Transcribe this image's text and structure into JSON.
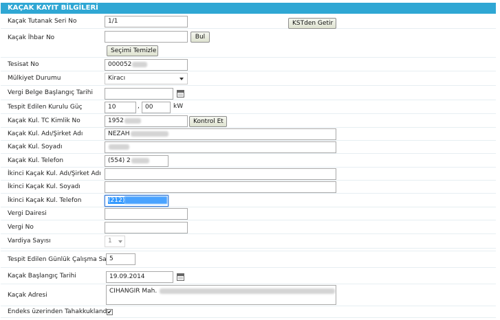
{
  "header": {
    "title": "KAÇAK KAYIT BİLGİLERİ"
  },
  "labels": {
    "tutanak_seri_no": "Kaçak Tutanak Seri No",
    "ihbar_no": "Kaçak İhbar No",
    "tesisat_no": "Tesisat No",
    "mulkiyet": "Mülkiyet Durumu",
    "vergi_baslangic": "Vergi Belge Başlangıç Tarihi",
    "kurulu_guc": "Tespit Edilen Kurulu Güç",
    "tc_kimlik": "Kaçak Kul. TC Kimlik No",
    "adi": "Kaçak Kul. Adı/Şirket Adı",
    "soyadi": "Kaçak Kul. Soyadı",
    "telefon": "Kaçak Kul. Telefon",
    "ikinci_adi": "İkinci Kaçak Kul. Adı/Şirket Adı",
    "ikinci_soyadi": "İkinci Kaçak Kul. Soyadı",
    "ikinci_telefon": "İkinci Kaçak Kul. Telefon",
    "vergi_dairesi": "Vergi Dairesi",
    "vergi_no": "Vergi No",
    "vardiya": "Vardiya Sayısı",
    "calisma_saati": "Tespit Edilen Günlük Çalışma Saati",
    "baslangic_tarihi": "Kaçak Başlangıç Tarihi",
    "adres": "Kaçak Adresi",
    "endeks": "Endeks üzerinden Tahakkuklandır"
  },
  "values": {
    "tutanak_seri_no": "1/1",
    "ihbar_no": "",
    "tesisat_no": "000052",
    "mulkiyet": "Kiracı",
    "vergi_baslangic": "",
    "kurulu_guc_int": "10",
    "kurulu_guc_sep": ",",
    "kurulu_guc_dec": "00",
    "kurulu_guc_unit": "kW",
    "tc_kimlik": "1952",
    "adi": "NEZAH",
    "soyadi": "",
    "telefon": "(554) 2",
    "ikinci_adi": "",
    "ikinci_soyadi": "",
    "ikinci_telefon": "(212)",
    "vergi_dairesi": "",
    "vergi_no": "",
    "vardiya": "1",
    "calisma_saati": "5",
    "baslangic_tarihi": "19.09.2014",
    "adres": "CIHANGIR Mah.",
    "endeks_checked": true,
    "endeks_mark": "✔"
  },
  "buttons": {
    "kst_getir": "KSTden Getir",
    "bul": "Bul",
    "secimi_temizle": "Seçimi Temizle",
    "kontrol_et": "Kontrol Et"
  },
  "colors": {
    "header_bg": "#2fa7d4",
    "selection": "#3399ff"
  }
}
